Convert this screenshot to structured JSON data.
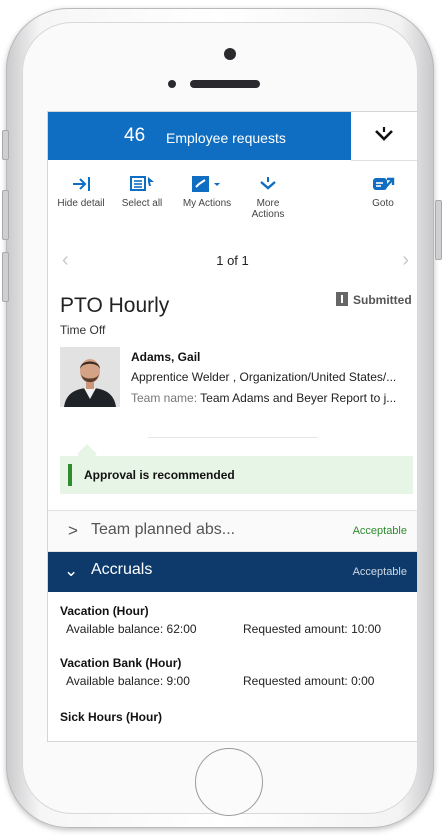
{
  "header": {
    "count": "46",
    "title": "Employee requests"
  },
  "toolbar": {
    "hide_detail": "Hide detail",
    "select_all": "Select all",
    "my_actions": "My Actions",
    "more_actions": "More Actions",
    "goto": "Goto"
  },
  "pager": {
    "text": "1 of 1"
  },
  "request": {
    "title": "PTO Hourly",
    "status": "Submitted",
    "type": "Time Off"
  },
  "employee": {
    "name": "Adams, Gail",
    "job": "Apprentice Welder , Organization/United States/...",
    "team_key": "Team name:",
    "team_value": "Team Adams and Beyer Report to j..."
  },
  "recommendation": "Approval is recommended",
  "sections": [
    {
      "label": "Team planned abs...",
      "status": "Acceptable"
    },
    {
      "label": "Accruals",
      "status": "Acceptable"
    }
  ],
  "accruals": [
    {
      "name": "Vacation (Hour)",
      "available": "Available balance: 62:00",
      "requested": "Requested amount: 10:00"
    },
    {
      "name": "Vacation Bank (Hour)",
      "available": "Available balance: 9:00",
      "requested": "Requested amount: 0:00"
    },
    {
      "name": "Sick Hours (Hour)"
    }
  ],
  "colors": {
    "header_blue": "#0f6ec2",
    "accruals_navy": "#0d3a6b",
    "accept_green": "#2e8b2e",
    "recommend_bg": "#e7f5e7"
  }
}
